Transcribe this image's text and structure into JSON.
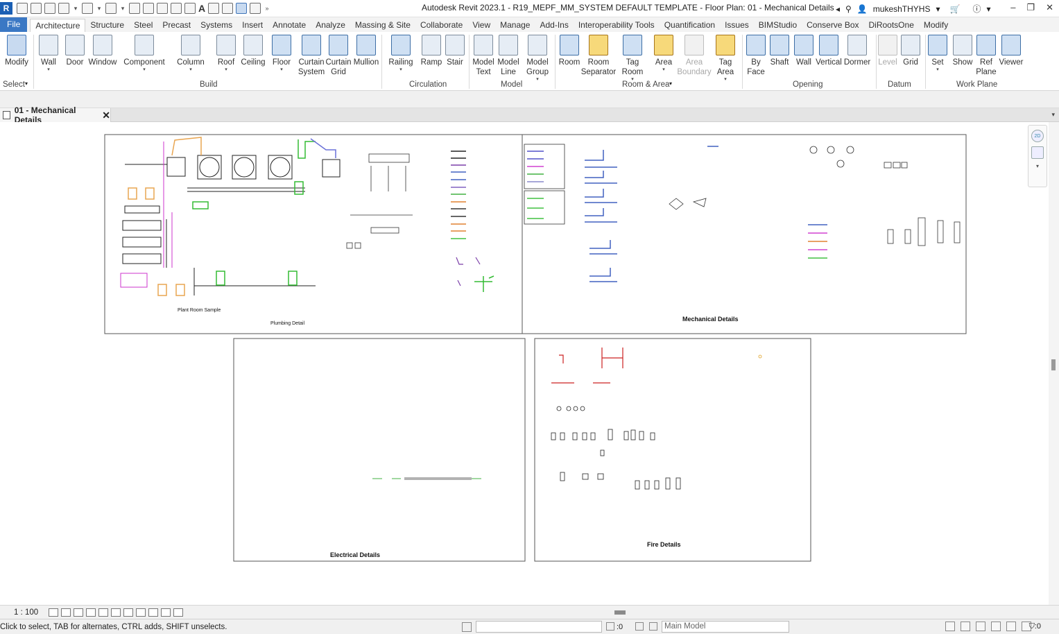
{
  "window": {
    "title": "Autodesk Revit 2023.1 - R19_MEPF_MM_SYSTEM DEFAULT TEMPLATE - Floor Plan: 01 - Mechanical Details",
    "user": "mukeshTHYHS",
    "app_icon": "R"
  },
  "tabs": [
    "File",
    "Architecture",
    "Structure",
    "Steel",
    "Precast",
    "Systems",
    "Insert",
    "Annotate",
    "Analyze",
    "Massing & Site",
    "Collaborate",
    "View",
    "Manage",
    "Add-Ins",
    "Interoperability Tools",
    "Quantification",
    "Issues",
    "BIMStudio",
    "Conserve Box",
    "DiRootsOne",
    "Modify"
  ],
  "active_tab": "Architecture",
  "ribbon": {
    "buttons": [
      {
        "l1": "Modify",
        "l2": ""
      },
      {
        "l1": "Wall",
        "l2": ""
      },
      {
        "l1": "Door",
        "l2": ""
      },
      {
        "l1": "Window",
        "l2": ""
      },
      {
        "l1": "Component",
        "l2": ""
      },
      {
        "l1": "Column",
        "l2": ""
      },
      {
        "l1": "Roof",
        "l2": ""
      },
      {
        "l1": "Ceiling",
        "l2": ""
      },
      {
        "l1": "Floor",
        "l2": ""
      },
      {
        "l1": "Curtain",
        "l2": "System"
      },
      {
        "l1": "Curtain",
        "l2": "Grid"
      },
      {
        "l1": "Mullion",
        "l2": ""
      },
      {
        "l1": "Railing",
        "l2": ""
      },
      {
        "l1": "Ramp",
        "l2": ""
      },
      {
        "l1": "Stair",
        "l2": ""
      },
      {
        "l1": "Model",
        "l2": "Text"
      },
      {
        "l1": "Model",
        "l2": "Line"
      },
      {
        "l1": "Model",
        "l2": "Group"
      },
      {
        "l1": "Room",
        "l2": ""
      },
      {
        "l1": "Room",
        "l2": "Separator"
      },
      {
        "l1": "Tag",
        "l2": "Room"
      },
      {
        "l1": "Area",
        "l2": ""
      },
      {
        "l1": "Area",
        "l2": "Boundary"
      },
      {
        "l1": "Tag",
        "l2": "Area"
      },
      {
        "l1": "By",
        "l2": "Face"
      },
      {
        "l1": "Shaft",
        "l2": ""
      },
      {
        "l1": "Wall",
        "l2": ""
      },
      {
        "l1": "Vertical",
        "l2": ""
      },
      {
        "l1": "Dormer",
        "l2": ""
      },
      {
        "l1": "Level",
        "l2": ""
      },
      {
        "l1": "Grid",
        "l2": ""
      },
      {
        "l1": "Set",
        "l2": ""
      },
      {
        "l1": "Show",
        "l2": ""
      },
      {
        "l1": "Ref",
        "l2": "Plane"
      },
      {
        "l1": "Viewer",
        "l2": ""
      }
    ],
    "panels": [
      "Select",
      "Build",
      "Circulation",
      "Model",
      "Room & Area",
      "Opening",
      "Datum",
      "Work Plane"
    ]
  },
  "view_tab": {
    "label": "01 - Mechanical Details",
    "close": "✕"
  },
  "sheets": {
    "plumbing_title": "Plumbing Detail",
    "plant_room": "Plant Room Sample",
    "mechanical_title": "Mechanical Details",
    "electrical_title": "Electrical Details",
    "fire_title": "Fire Details"
  },
  "view_control": {
    "scale": "1 : 100"
  },
  "status": {
    "text": "Click to select, TAB for alternates, CTRL adds, SHIFT unselects.",
    "worksets_value": ":0",
    "design_option": "Main Model",
    "filter_count": ":0"
  },
  "nav": {
    "badge_2d": "2D"
  }
}
